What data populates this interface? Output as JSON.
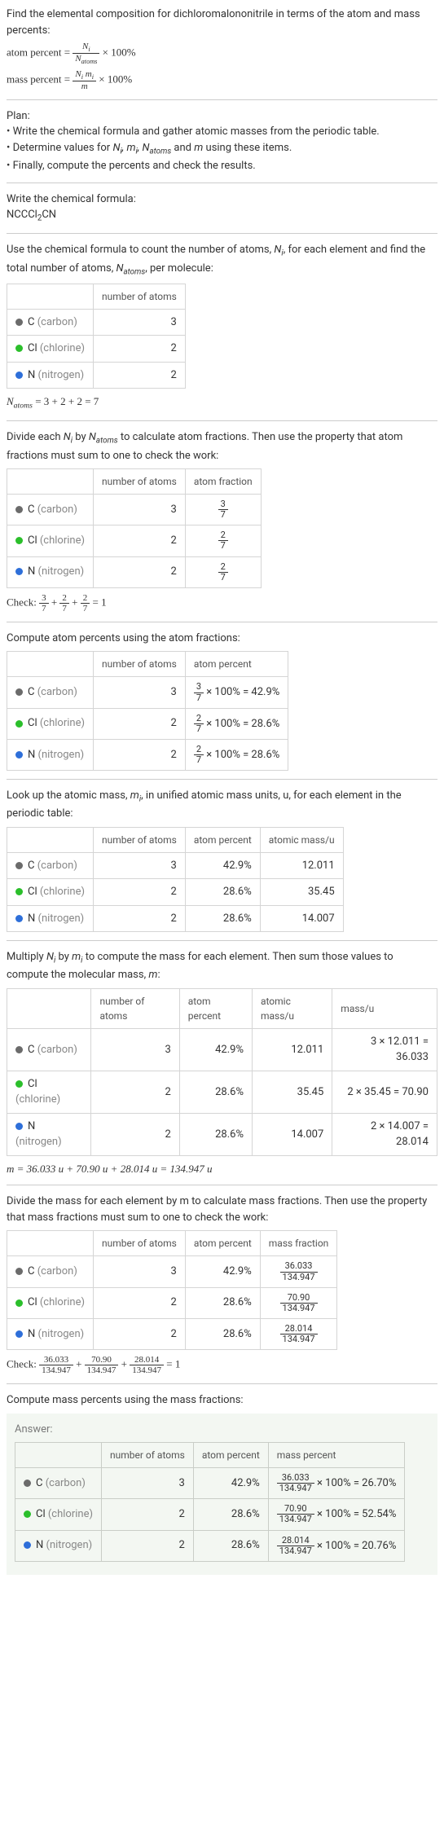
{
  "intro": {
    "line1": "Find the elemental composition for dichloromalononitrile in terms of the atom and mass percents:",
    "ap_label": "atom percent = ",
    "ap_num": "N_i",
    "ap_den": "N_atoms",
    "ap_tail": " × 100%",
    "mp_label": "mass percent = ",
    "mp_num": "N_i m_i",
    "mp_den": "m",
    "mp_tail": " × 100%"
  },
  "plan": {
    "heading": "Plan:",
    "b1": "• Write the chemical formula and gather atomic masses from the periodic table.",
    "b2_a": "• Determine values for ",
    "b2_b": " using these items.",
    "b2_vars": "N_i, m_i, N_atoms and m",
    "b3": "• Finally, compute the percents and check the results."
  },
  "formula_section": {
    "heading": "Write the chemical formula:",
    "formula_plain": "NCCCl",
    "formula_sub": "2",
    "formula_tail": "CN"
  },
  "count_section": {
    "text_a": "Use the chemical formula to count the number of atoms, ",
    "text_b": ", for each element and find the total number of atoms, ",
    "text_c": ", per molecule:",
    "Ni": "N_i",
    "Natoms": "N_atoms"
  },
  "headers": {
    "number_of_atoms": "number of atoms",
    "atom_fraction": "atom fraction",
    "atom_percent": "atom percent",
    "atomic_mass": "atomic mass/u",
    "mass_u": "mass/u",
    "mass_fraction": "mass fraction",
    "mass_percent": "mass percent"
  },
  "elements": {
    "c": {
      "sym": "C",
      "name": "(carbon)"
    },
    "cl": {
      "sym": "Cl",
      "name": "(chlorine)"
    },
    "n": {
      "sym": "N",
      "name": "(nitrogen)"
    }
  },
  "counts": {
    "c": "3",
    "cl": "2",
    "n": "2"
  },
  "natoms_line": {
    "pre": "N",
    "sub": "atoms",
    "rest": " = 3 + 2 + 2 = 7"
  },
  "frac_section": {
    "text_a": "Divide each ",
    "text_b": " by ",
    "text_c": " to calculate atom fractions. Then use the property that atom fractions must sum to one to check the work:"
  },
  "fracs": {
    "c": {
      "num": "3",
      "den": "7"
    },
    "cl": {
      "num": "2",
      "den": "7"
    },
    "n": {
      "num": "2",
      "den": "7"
    }
  },
  "check1": {
    "label": "Check: ",
    "eq": " = 1"
  },
  "atom_pct_heading": "Compute atom percents using the atom fractions:",
  "atom_pct": {
    "c": {
      "num": "3",
      "den": "7",
      "tail": " × 100% = 42.9%"
    },
    "cl": {
      "num": "2",
      "den": "7",
      "tail": " × 100% = 28.6%"
    },
    "n": {
      "num": "2",
      "den": "7",
      "tail": " × 100% = 28.6%"
    }
  },
  "atom_pct_short": {
    "c": "42.9%",
    "cl": "28.6%",
    "n": "28.6%"
  },
  "mass_lookup": {
    "text_a": "Look up the atomic mass, ",
    "text_b": ", in unified atomic mass units, u, for each element in the periodic table:",
    "mi": "m_i"
  },
  "atomic_mass": {
    "c": "12.011",
    "cl": "35.45",
    "n": "14.007"
  },
  "mass_calc": {
    "text_a": "Multiply ",
    "text_b": " by ",
    "text_c": " to compute the mass for each element. Then sum those values to compute the molecular mass, ",
    "text_d": ":",
    "m": "m"
  },
  "mass_u": {
    "c": "3 × 12.011 = 36.033",
    "cl": "2 × 35.45 = 70.90",
    "n": "2 × 14.007 = 28.014"
  },
  "m_line": "m = 36.033 u + 70.90 u + 28.014 u = 134.947 u",
  "mass_frac_heading": "Divide the mass for each element by m to calculate mass fractions. Then use the property that mass fractions must sum to one to check the work:",
  "mass_frac": {
    "c": {
      "num": "36.033",
      "den": "134.947"
    },
    "cl": {
      "num": "70.90",
      "den": "134.947"
    },
    "n": {
      "num": "28.014",
      "den": "134.947"
    }
  },
  "check2": {
    "label": "Check: ",
    "eq": " = 1"
  },
  "mass_pct_heading": "Compute mass percents using the mass fractions:",
  "answer_label": "Answer:",
  "mass_pct": {
    "c": {
      "num": "36.033",
      "den": "134.947",
      "tail": " × 100% = 26.70%"
    },
    "cl": {
      "num": "70.90",
      "den": "134.947",
      "tail": " × 100% = 52.54%"
    },
    "n": {
      "num": "28.014",
      "den": "134.947",
      "tail": " × 100% = 20.76%"
    }
  },
  "chart_data": {
    "type": "table",
    "title": "Elemental composition of dichloromalononitrile",
    "elements": [
      "C",
      "Cl",
      "N"
    ],
    "number_of_atoms": [
      3,
      2,
      2
    ],
    "atom_percent": [
      42.9,
      28.6,
      28.6
    ],
    "atomic_mass_u": [
      12.011,
      35.45,
      14.007
    ],
    "element_mass_u": [
      36.033,
      70.9,
      28.014
    ],
    "molecular_mass_u": 134.947,
    "mass_percent": [
      26.7,
      52.54,
      20.76
    ]
  }
}
